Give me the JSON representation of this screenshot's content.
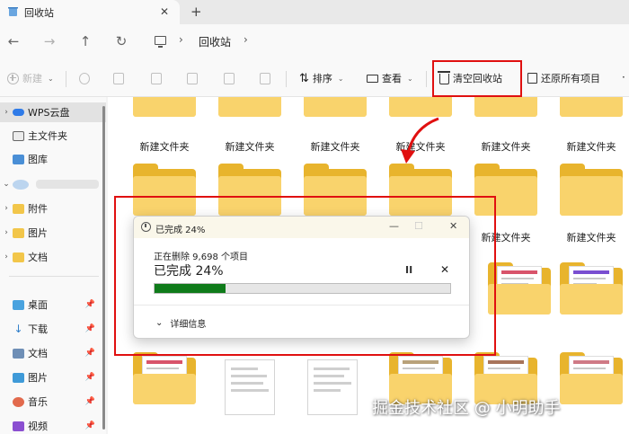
{
  "window": {
    "tab_title": "回收站",
    "tab_close": "✕",
    "new_tab": "+"
  },
  "nav": {
    "back": "←",
    "forward": "→",
    "up": "↑",
    "refresh": "↻",
    "separator": "›",
    "breadcrumb": "回收站"
  },
  "toolbar": {
    "new_label": "新建",
    "sort_label": "排序",
    "view_label": "查看",
    "empty_bin_label": "清空回收站",
    "restore_all_label": "还原所有项目",
    "caret": "⌄",
    "icons": [
      "cut-icon",
      "copy-icon",
      "paste-icon",
      "rename-icon",
      "share-icon",
      "delete-icon"
    ]
  },
  "sidebar": {
    "items": [
      {
        "label": "WPS云盘",
        "icon": "cloud-icon",
        "chevron": "›"
      },
      {
        "label": "主文件夹",
        "icon": "home-icon"
      },
      {
        "label": "图库",
        "icon": "gallery-icon"
      },
      {
        "label": "",
        "icon": "cloud-account-icon",
        "chevron": "⌄"
      },
      {
        "label": "附件",
        "icon": "folder-icon",
        "chevron": "›"
      },
      {
        "label": "图片",
        "icon": "folder-icon",
        "chevron": "›"
      },
      {
        "label": "文档",
        "icon": "folder-icon",
        "chevron": "›"
      },
      {
        "label": "桌面",
        "icon": "desktop-icon"
      },
      {
        "label": "下载",
        "icon": "download-icon"
      },
      {
        "label": "文档",
        "icon": "documents-icon"
      },
      {
        "label": "图片",
        "icon": "pictures-icon"
      },
      {
        "label": "音乐",
        "icon": "music-icon"
      },
      {
        "label": "视频",
        "icon": "video-icon"
      }
    ],
    "pin_glyph": "📌"
  },
  "content": {
    "folder_label": "新建文件夹"
  },
  "dialog": {
    "title": "已完成 24%",
    "minimize": "—",
    "maximize": "☐",
    "close": "✕",
    "subtitle": "正在删除 9,698 个项目",
    "status": "已完成 24%",
    "progress_percent": 24,
    "pause": "II",
    "cancel": "✕",
    "details_chevron": "⌄",
    "details_label": "详细信息"
  },
  "colors": {
    "highlight_box": "#e01010",
    "progress": "#0f7b1a",
    "folder": "#f9d36c"
  },
  "watermark": "掘金技术社区 @ 小明助手"
}
